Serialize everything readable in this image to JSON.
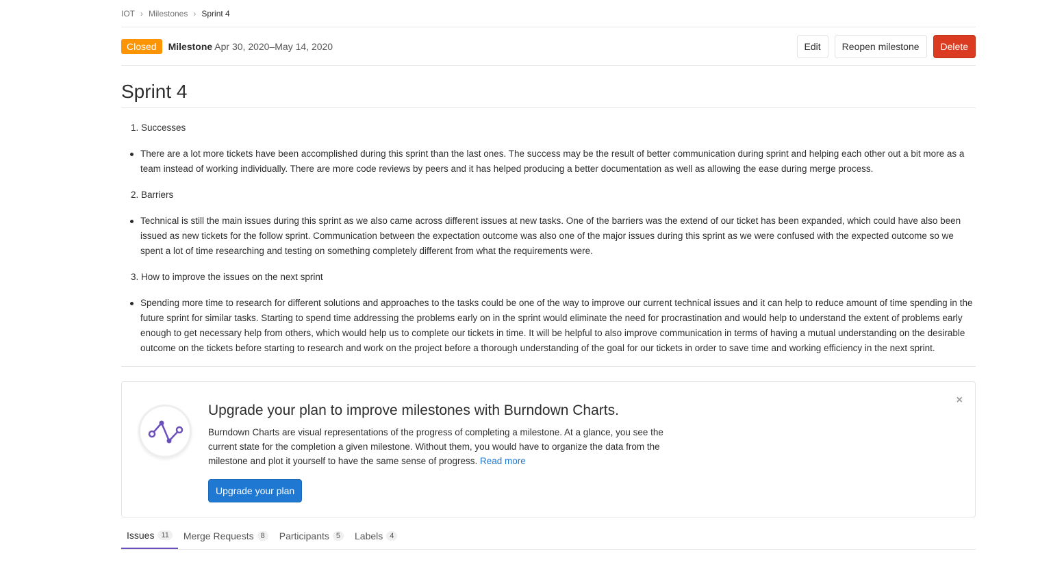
{
  "breadcrumb": {
    "project": "IOT",
    "section": "Milestones",
    "current": "Sprint 4"
  },
  "header": {
    "status": "Closed",
    "label": "Milestone",
    "dates": "Apr 30, 2020–May 14, 2020",
    "edit_button": "Edit",
    "reopen_button": "Reopen milestone",
    "delete_button": "Delete"
  },
  "title": "Sprint 4",
  "description": {
    "heading1": "1. Successes",
    "bullet1": "There are a lot more tickets have been accomplished during this sprint than the last ones. The success may be the result of better communication during sprint and helping each other out a bit more as a team instead of working individually. There are more code reviews by peers and it has helped producing a better documentation as well as allowing the ease during merge process.",
    "heading2": "2. Barriers",
    "bullet2": "Technical is still the main issues during this sprint as we also came across different issues at new tasks. One of the barriers was the extend of our ticket has been expanded, which could have also been issued as new tickets for the follow sprint. Communication between the expectation outcome was also one of the major issues during this sprint as we were confused with the expected outcome so we spent a lot of time researching and testing on something completely different from what the requirements were.",
    "heading3": "3. How to improve the issues on the next sprint",
    "bullet3": "Spending more time to research for different solutions and approaches to the tasks could be one of the way to improve our current technical issues and it can help to reduce amount of time spending in the future sprint for similar tasks. Starting to spend time addressing the problems early on in the sprint would eliminate the need for procrastination and would help to understand the extent of problems early enough to get necessary help from others, which would help us to complete our tickets in time. It will be helpful to also improve communication in terms of having a mutual understanding on the desirable outcome on the tickets before starting to research and work on the project before a thorough understanding of the goal for our tickets in order to save time and working efficiency in the next sprint."
  },
  "promo": {
    "heading": "Upgrade your plan to improve milestones with Burndown Charts.",
    "text": "Burndown Charts are visual representations of the progress of completing a milestone. At a glance, you see the current state for the completion a given milestone. Without them, you would have to organize the data from the milestone and plot it yourself to have the same sense of progress. ",
    "link": "Read more",
    "button": "Upgrade your plan",
    "close": "×",
    "icon": "burndown-chart-icon",
    "accent": "#6b4fbb"
  },
  "tabs": [
    {
      "label": "Issues",
      "count": "11"
    },
    {
      "label": "Merge Requests",
      "count": "8"
    },
    {
      "label": "Participants",
      "count": "5"
    },
    {
      "label": "Labels",
      "count": "4"
    }
  ],
  "colors": {
    "closed_badge": "#fc9403",
    "delete": "#db3b21",
    "primary": "#1f78d1",
    "active_tab": "#6b4fbb"
  }
}
